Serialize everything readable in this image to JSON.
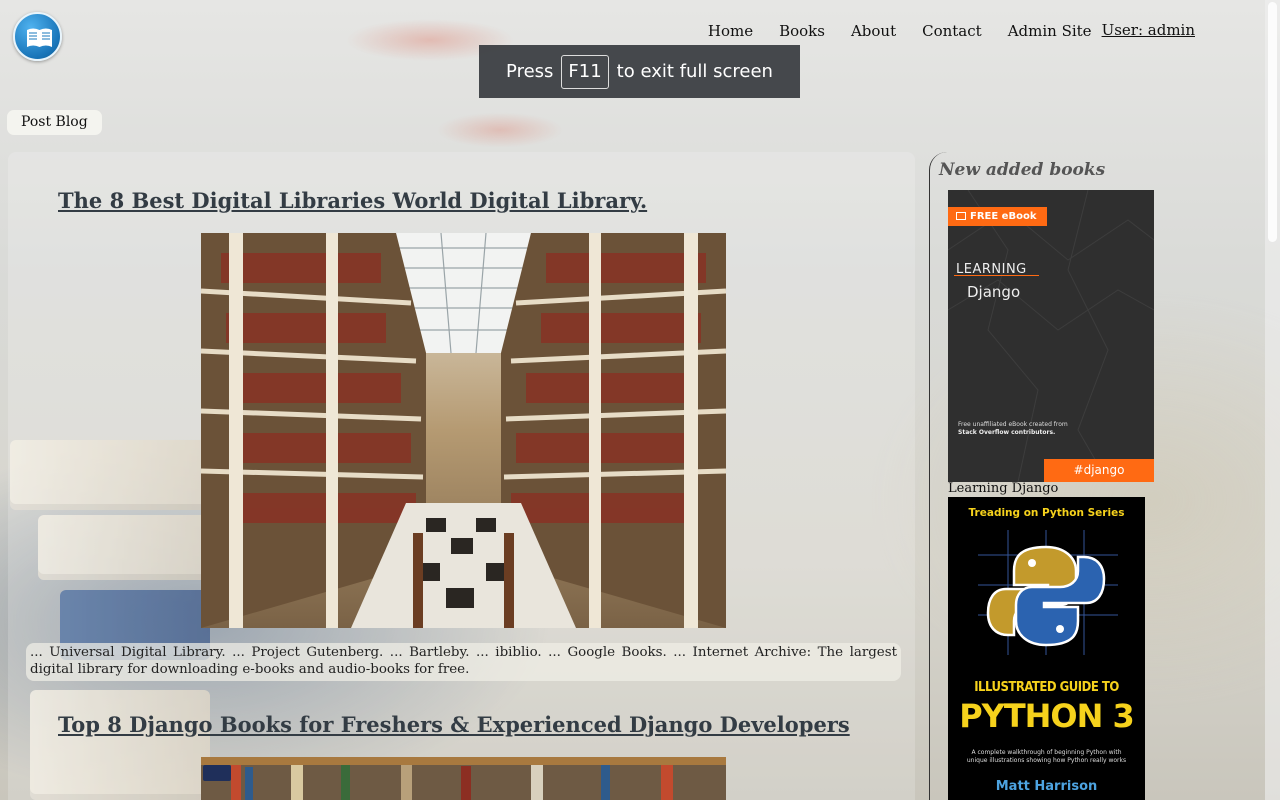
{
  "nav": {
    "home": "Home",
    "books": "Books",
    "about": "About",
    "contact": "Contact",
    "admin_site": "Admin Site",
    "user": "User: admin"
  },
  "fullscreen_toast": {
    "prefix": "Press",
    "key": "F11",
    "suffix": "to exit full screen"
  },
  "post_blog_label": "Post Blog",
  "posts": [
    {
      "title": "The 8 Best Digital Libraries World Digital Library.",
      "excerpt": "... Universal Digital Library. ... Project Gutenberg. ... Bartleby. ... ibiblio. ... Google Books. ... Internet Archive: The largest digital library for downloading e-books and audio-books for free."
    },
    {
      "title": "Top 8 Django Books for Freshers & Experienced Django Developers"
    }
  ],
  "sidebar": {
    "title": "New added books",
    "books": [
      {
        "caption": "Learning Django",
        "cover_badge": "FREE eBook",
        "cover_title_1": "LEARNING",
        "cover_title_2": "Django",
        "cover_note_1": "Free unaffiliated eBook created from",
        "cover_note_2": "Stack Overflow contributors.",
        "cover_tag": "#django"
      },
      {
        "cover_series": "Treading on Python Series",
        "cover_title_1": "ILLUSTRATED GUIDE TO",
        "cover_title_2": "PYTHON 3",
        "cover_sub_1": "A complete walkthrough of beginning Python with",
        "cover_sub_2": "unique illustrations showing how Python really works",
        "cover_author": "Matt Harrison"
      }
    ]
  },
  "colors": {
    "nav_text": "#111111",
    "post_title": "#333c44",
    "toast_bg": "#3a3e42",
    "django_accent": "#ff6a13",
    "python_title": "#f6d21c"
  }
}
